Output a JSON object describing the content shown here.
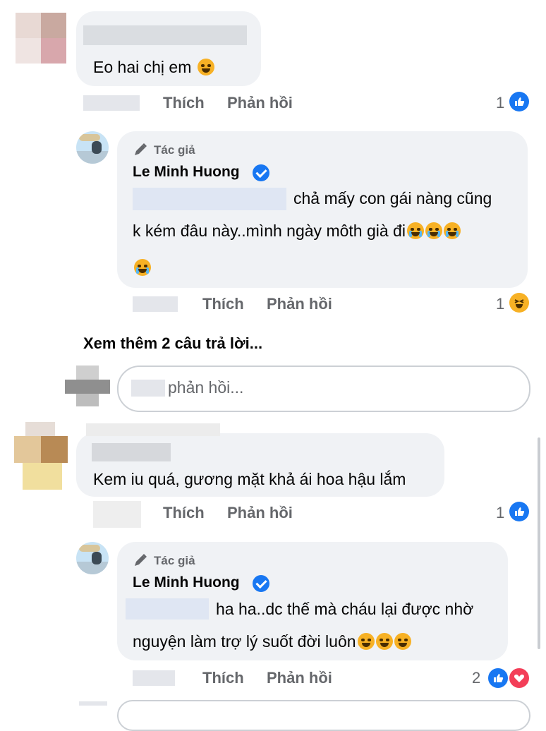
{
  "comments": [
    {
      "text": "Eo hai chị em",
      "actions": {
        "like": "Thích",
        "reply": "Phản hồi"
      },
      "reaction_count": "1",
      "reply": {
        "author_tag": "Tác giả",
        "author": "Le Minh Huong",
        "line1": "chả mấy con gái nàng cũng",
        "line2": "k kém đâu này..mình ngày môth già đi",
        "actions": {
          "like": "Thích",
          "reply": "Phản hồi"
        },
        "reaction_count": "1"
      }
    },
    {
      "text": "Kem iu quá, gương mặt khả ái hoa hậu lắm",
      "actions": {
        "like": "Thích",
        "reply": "Phản hồi"
      },
      "reaction_count": "1",
      "reply": {
        "author_tag": "Tác giả",
        "author": "Le Minh Huong",
        "line1": "ha ha..dc thế mà cháu lại được nhờ",
        "line2": "nguyện làm trợ lý suốt đời luôn",
        "actions": {
          "like": "Thích",
          "reply": "Phản hồi"
        },
        "reaction_count": "2"
      }
    }
  ],
  "view_more": "Xem thêm 2 câu trả lời...",
  "reply_input": {
    "placeholder": "phản hồi..."
  },
  "icons": {
    "like": "like-icon",
    "haha": "haha-icon",
    "heart": "heart-icon",
    "verified": "verified-badge-icon",
    "pencil": "pencil-icon"
  },
  "colors": {
    "accent": "#1877f2",
    "bubble": "#f0f2f5",
    "muted": "#65676b"
  }
}
